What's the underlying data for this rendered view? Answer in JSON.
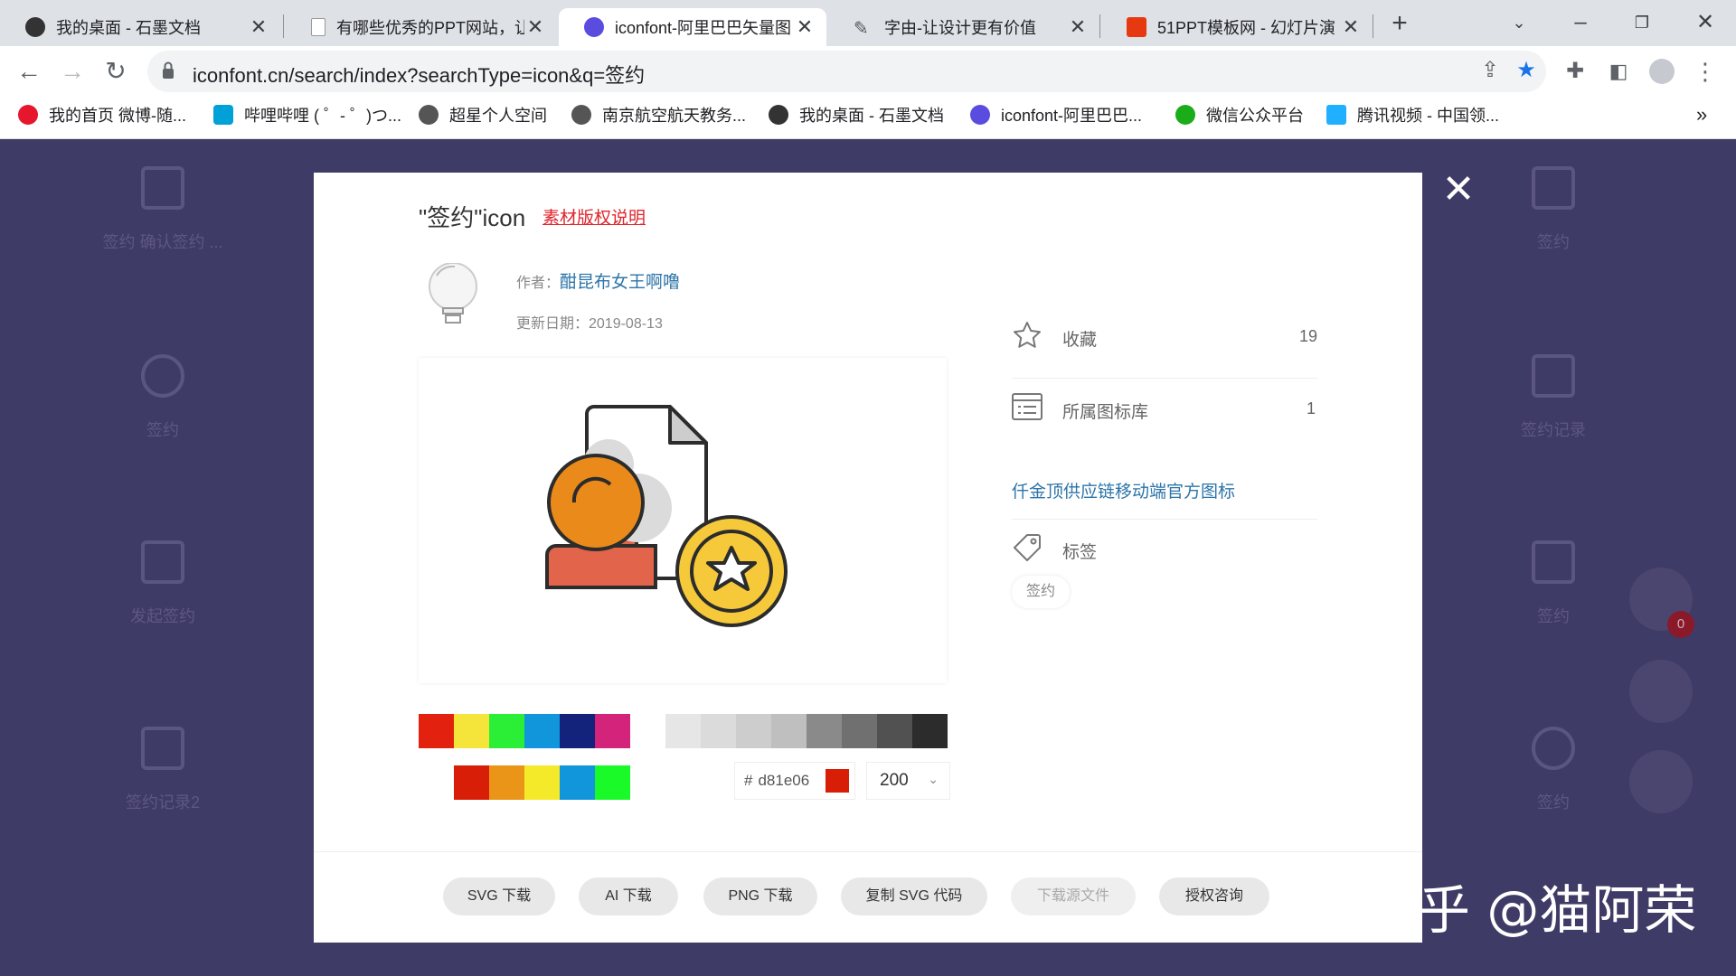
{
  "tabs": [
    {
      "title": "我的桌面 - 石墨文档",
      "icon": "shimo-icon"
    },
    {
      "title": "有哪些优秀的PPT网站，让",
      "icon": "doc-icon"
    },
    {
      "title": "iconfont-阿里巴巴矢量图",
      "icon": "iconfont-icon"
    },
    {
      "title": "字由-让设计更有价值",
      "icon": "pen-icon"
    },
    {
      "title": "51PPT模板网 - 幻灯片演",
      "icon": "51ppt-icon"
    }
  ],
  "new_tab": "+",
  "url": "iconfont.cn/search/index?searchType=icon&q=签约",
  "bookmarks": [
    {
      "label": "我的首页 微博-随...",
      "color": "#e6162d"
    },
    {
      "label": "哔哩哔哩 ( ゜- ゜)つ...",
      "color": "#00a1d6"
    },
    {
      "label": "超星个人空间",
      "color": "#555"
    },
    {
      "label": "南京航空航天教务...",
      "color": "#555"
    },
    {
      "label": "我的桌面 - 石墨文档",
      "color": "#333"
    },
    {
      "label": "iconfont-阿里巴巴...",
      "color": "#5b4ce0"
    },
    {
      "label": "微信公众平台",
      "color": "#1aad19"
    },
    {
      "label": "腾讯视频 - 中国领...",
      "color": "#20b0ff"
    }
  ],
  "bookmarks_more": "»",
  "background_icons": [
    {
      "label": "签约 确认签约 ..."
    },
    {
      "label": "签约"
    },
    {
      "label": "签约"
    },
    {
      "label": "签约记录"
    },
    {
      "label": "发起签约"
    },
    {
      "label": "签约"
    },
    {
      "label": "签约记录2"
    },
    {
      "label": "签约"
    }
  ],
  "cart_count": "0",
  "modal": {
    "title": "\"签约\"icon",
    "copyright_link": "素材版权说明",
    "author_label": "作者：",
    "author_name": "酣昆布女王啊噜",
    "date": "更新日期：2019-08-13",
    "favorite_label": "收藏",
    "favorite_count": "19",
    "library_label": "所属图标库",
    "library_count": "1",
    "library_name": "仟金顶供应链移动端官方图标",
    "tag_label": "标签",
    "tag": "签约",
    "palette_row1": [
      "#e2220f",
      "#f5e53a",
      "#2bef37",
      "#1296db",
      "#13227a",
      "#d4237a",
      "#ffffff",
      "#e6e6e6",
      "#dbdbdb",
      "#cdcdcd",
      "#bfbfbf",
      "#8a8a8a",
      "#707070",
      "#515151",
      "#2c2c2c"
    ],
    "palette_row2": [
      "#ffffff",
      "#d81e06",
      "#ea9518",
      "#f4ea2a",
      "#1296db",
      "#1afa29"
    ],
    "hex_prefix": "#",
    "hex_value": "d81e06",
    "hex_color": "#d81e06",
    "size": "200",
    "buttons": [
      "SVG 下载",
      "AI 下载",
      "PNG 下载",
      "复制 SVG 代码",
      "下载源文件",
      "授权咨询"
    ]
  },
  "watermark": "知乎 @猫阿荣"
}
